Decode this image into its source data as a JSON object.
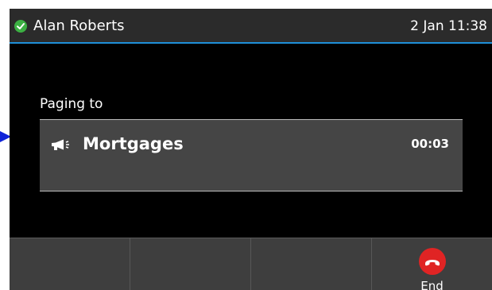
{
  "status_bar": {
    "user_name": "Alan Roberts",
    "datetime": "2 Jan 11:38",
    "presence_status": "available",
    "presence_color": "#3cb043",
    "accent_color": "#1f8fd8"
  },
  "main": {
    "paging_label": "Paging to",
    "call": {
      "icon": "megaphone-icon",
      "name": "Mortgages",
      "timer": "00:03"
    }
  },
  "softkeys": [
    {
      "label": ""
    },
    {
      "label": ""
    },
    {
      "label": ""
    },
    {
      "label": "End",
      "icon": "end-call-icon",
      "color": "#e02424"
    }
  ]
}
